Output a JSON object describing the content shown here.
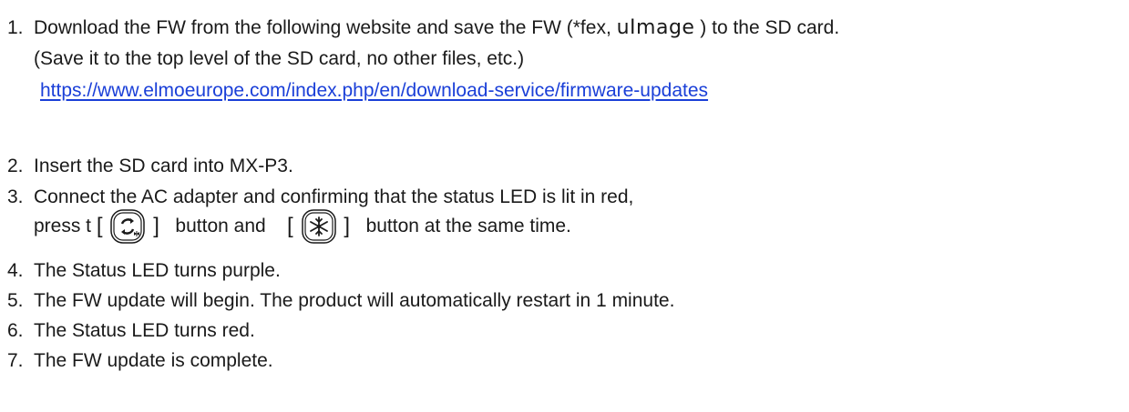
{
  "steps": [
    {
      "num": "1.",
      "text_a": "Download the FW from the following website and save the FW (*fex,  ",
      "text_mono": "uImage",
      "text_b": " ) to the SD card."
    },
    {
      "sub": "(Save it to the top level of the SD card, no other files, etc.)"
    },
    {
      "link": "https://www.elmoeurope.com/index.php/en/download-service/firmware-updates"
    },
    {
      "num": "2.",
      "text": "Insert the SD card into MX-P3."
    },
    {
      "num": "3.",
      "text": "Connect the AC adapter and confirming that the status LED is lit in red,"
    },
    {
      "press_prefix": "press t",
      "bracket_open": "[",
      "bracket_close": "]",
      "button_and": "button and",
      "same_time": "button at the same time."
    },
    {
      "num": "4.",
      "text": "The Status LED turns purple."
    },
    {
      "num": "5.",
      "text": "The FW update will begin. The product will automatically restart in 1 minute."
    },
    {
      "num": "6.",
      "text": "The Status LED turns red."
    },
    {
      "num": "7.",
      "text": "The FW update is complete."
    }
  ],
  "icons": [
    "rotate-image-button-icon",
    "freeze-button-icon"
  ],
  "colors": {
    "text": "#1a1a1a",
    "link": "#1a3fd8"
  }
}
